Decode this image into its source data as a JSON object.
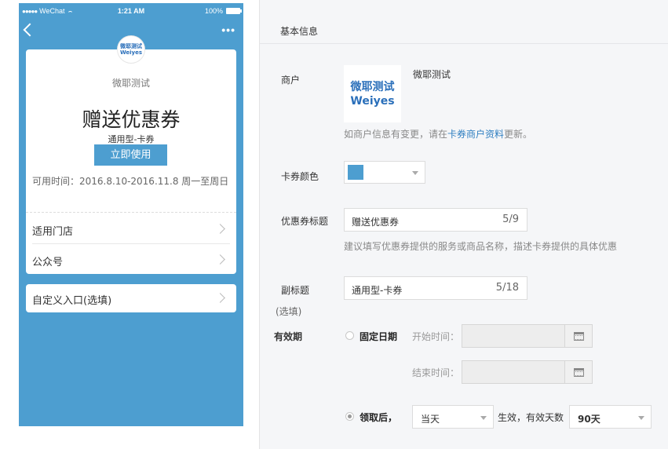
{
  "statusbar": {
    "signal": "●●●●●",
    "carrier": "WeChat",
    "time": "1:21 AM",
    "battery": "100%"
  },
  "navbar": {
    "more": "•••"
  },
  "preview": {
    "logo_line1": "微耶测试",
    "logo_line2": "Weiyes",
    "merchant_name": "微耶测试",
    "coupon_title": "赠送优惠券",
    "coupon_subtitle": "通用型-卡券",
    "use_button": "立即使用",
    "validity": "可用时间：2016.8.10-2016.11.8 周一至周日",
    "rows": [
      "适用门店",
      "公众号"
    ],
    "custom_entry": "自定义入口(选填)"
  },
  "form": {
    "section_title": "基本信息",
    "merchant_label": "商户",
    "merchant_logo_line1": "微耶测试",
    "merchant_logo_line2": "Weiyes",
    "merchant_name": "微耶测试",
    "merchant_hint_pre": "如商户信息有变更，请在",
    "merchant_hint_link": "卡券商户资料",
    "merchant_hint_post": "更新。",
    "color_label": "卡券颜色",
    "card_color": "#4d9ed0",
    "title_label": "优惠券标题",
    "title_value": "赠送优惠券",
    "title_count": "5/9",
    "title_hint": "建议填写优惠券提供的服务或商品名称，描述卡券提供的具体优惠",
    "subtitle_label": "副标题",
    "subtitle_optional": "(选填)",
    "subtitle_value": "通用型-卡券",
    "subtitle_count": "5/18",
    "validity_label": "有效期",
    "fixed_date_label": "固定日期",
    "start_label": "开始时间：",
    "end_label": "结束时间：",
    "after_receive_label": "领取后，",
    "effective_select": "当天",
    "effective_text": "生效，有效天数",
    "days_select": "90天"
  }
}
